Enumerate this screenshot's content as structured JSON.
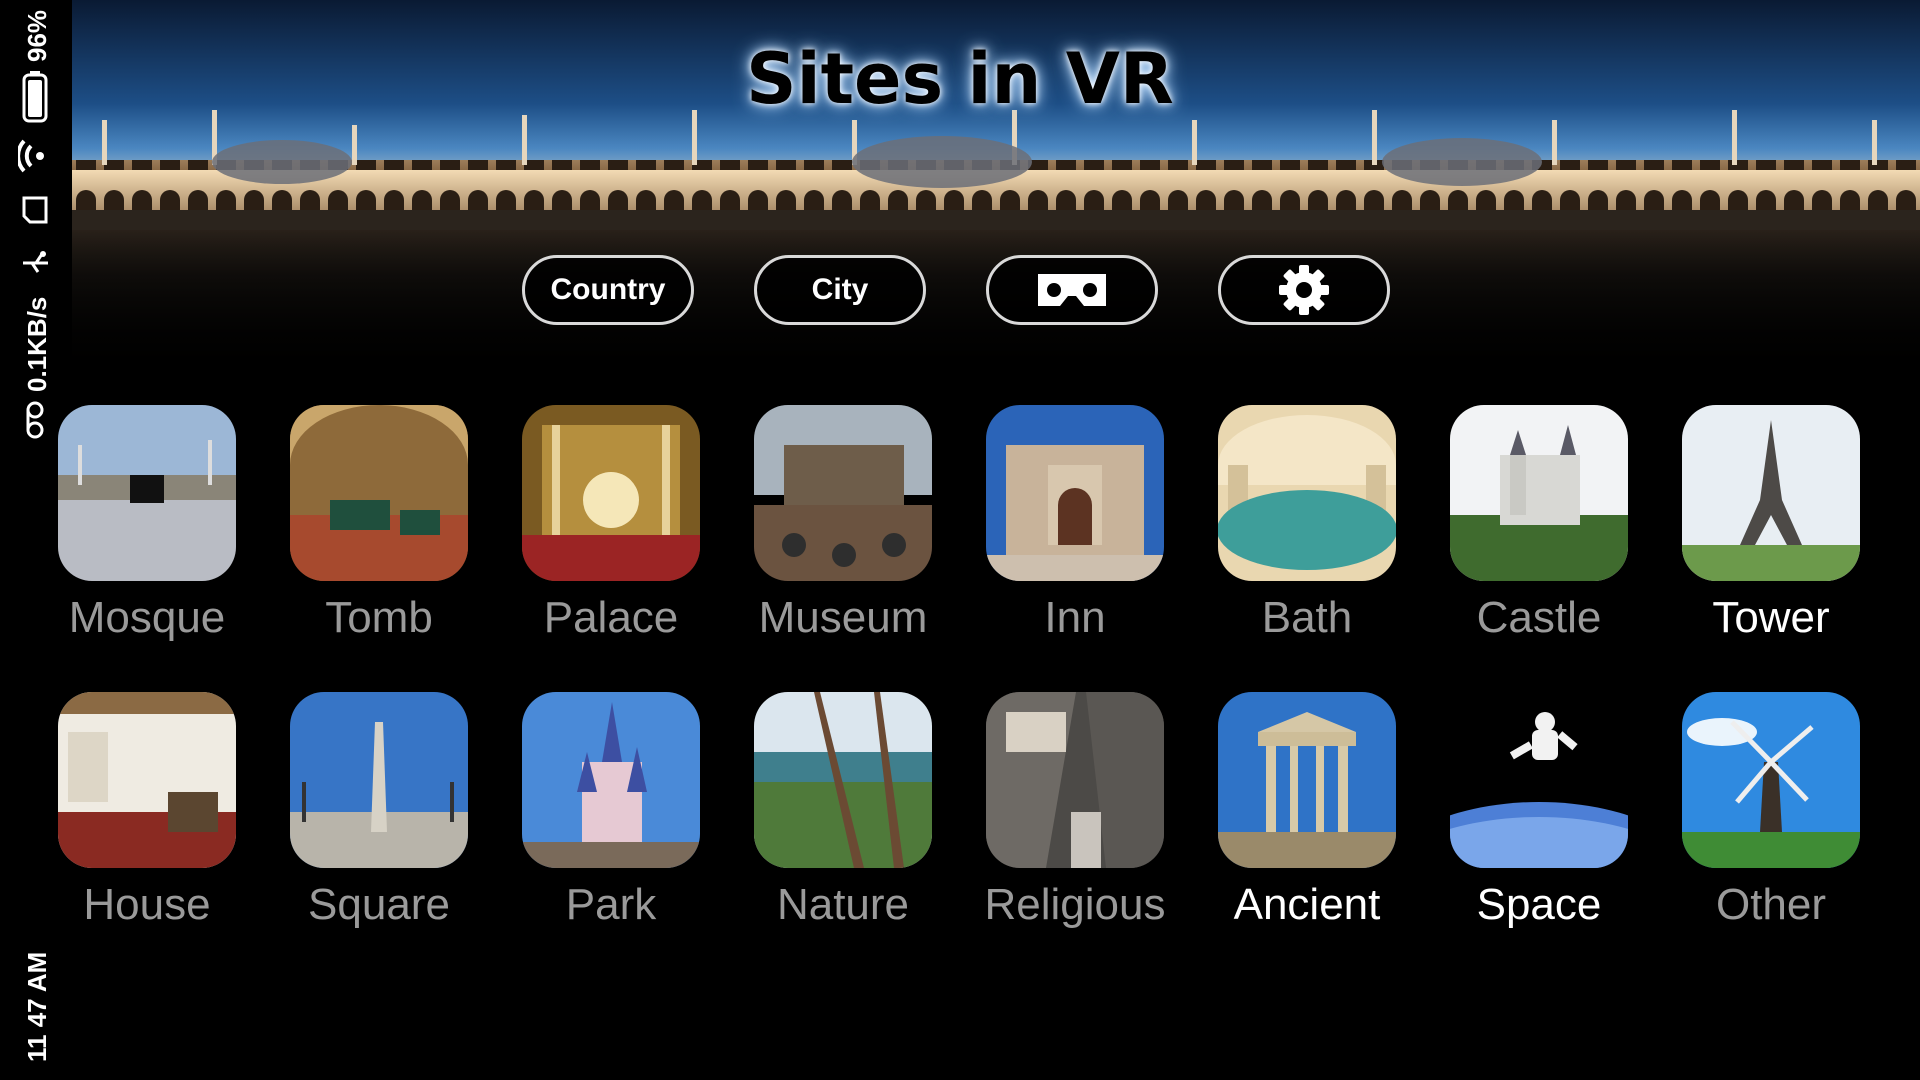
{
  "status_bar": {
    "battery_percent": "96%",
    "network_speed": "0.1KB/s",
    "time": "11 47 AM",
    "icons": [
      "battery-icon",
      "wifi-icon",
      "sim-icon",
      "usb-icon",
      "voicemail-icon"
    ]
  },
  "header": {
    "title": "Sites in VR",
    "buttons": {
      "country": "Country",
      "city": "City",
      "vr_icon": "vr-headset-icon",
      "settings_icon": "gear-icon"
    }
  },
  "categories": [
    {
      "label": "Mosque",
      "highlighted": false,
      "thumb": "mosque-photo"
    },
    {
      "label": "Tomb",
      "highlighted": false,
      "thumb": "tomb-photo"
    },
    {
      "label": "Palace",
      "highlighted": false,
      "thumb": "palace-photo"
    },
    {
      "label": "Museum",
      "highlighted": false,
      "thumb": "museum-photo"
    },
    {
      "label": "Inn",
      "highlighted": false,
      "thumb": "inn-photo"
    },
    {
      "label": "Bath",
      "highlighted": false,
      "thumb": "bath-photo"
    },
    {
      "label": "Castle",
      "highlighted": false,
      "thumb": "castle-photo"
    },
    {
      "label": "Tower",
      "highlighted": true,
      "thumb": "tower-photo"
    },
    {
      "label": "House",
      "highlighted": false,
      "thumb": "house-photo"
    },
    {
      "label": "Square",
      "highlighted": false,
      "thumb": "square-photo"
    },
    {
      "label": "Park",
      "highlighted": false,
      "thumb": "park-photo"
    },
    {
      "label": "Nature",
      "highlighted": false,
      "thumb": "nature-photo"
    },
    {
      "label": "Religious",
      "highlighted": false,
      "thumb": "religious-photo"
    },
    {
      "label": "Ancient",
      "highlighted": true,
      "thumb": "ancient-photo"
    },
    {
      "label": "Space",
      "highlighted": true,
      "thumb": "space-photo"
    },
    {
      "label": "Other",
      "highlighted": false,
      "thumb": "other-photo"
    }
  ],
  "colors": {
    "background": "#000000",
    "label_dim": "#9a9a9a",
    "label_bright": "#ffffff",
    "button_border": "#d9d9d9"
  }
}
